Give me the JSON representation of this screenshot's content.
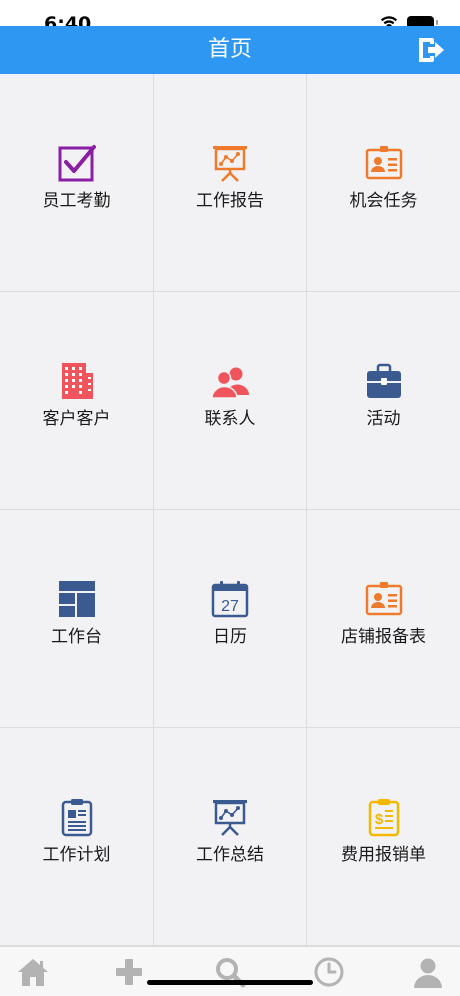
{
  "status_bar": {
    "time": "6:40"
  },
  "nav": {
    "title": "首页"
  },
  "grid": {
    "items": [
      {
        "label": "员工考勤",
        "icon": "check-square-icon",
        "color": "#8a1fa3"
      },
      {
        "label": "工作报告",
        "icon": "presentation-board-icon",
        "color": "#f07a2c"
      },
      {
        "label": "机会任务",
        "icon": "id-badge-icon",
        "color": "#f07a2c"
      },
      {
        "label": "客户客户",
        "icon": "building-icon",
        "color": "#f0545c"
      },
      {
        "label": "联系人",
        "icon": "people-icon",
        "color": "#f0545c"
      },
      {
        "label": "活动",
        "icon": "briefcase-icon",
        "color": "#3b5a8f"
      },
      {
        "label": "工作台",
        "icon": "dashboard-layout-icon",
        "color": "#3b5a8f"
      },
      {
        "label": "日历",
        "icon": "calendar-icon",
        "color": "#3b5a8f",
        "day": "27"
      },
      {
        "label": "店铺报备表",
        "icon": "id-badge-icon",
        "color": "#f07a2c"
      },
      {
        "label": "工作计划",
        "icon": "clipboard-list-icon",
        "color": "#3b5a8f"
      },
      {
        "label": "工作总结",
        "icon": "presentation-board-icon",
        "color": "#3b5a8f"
      },
      {
        "label": "费用报销单",
        "icon": "dollar-clipboard-icon",
        "color": "#f5b800"
      }
    ]
  },
  "tab_bar": {
    "tabs": [
      {
        "icon": "home-icon"
      },
      {
        "icon": "plus-icon"
      },
      {
        "icon": "search-icon"
      },
      {
        "icon": "clock-icon"
      },
      {
        "icon": "user-icon"
      }
    ],
    "color": "#b3b3b3"
  }
}
